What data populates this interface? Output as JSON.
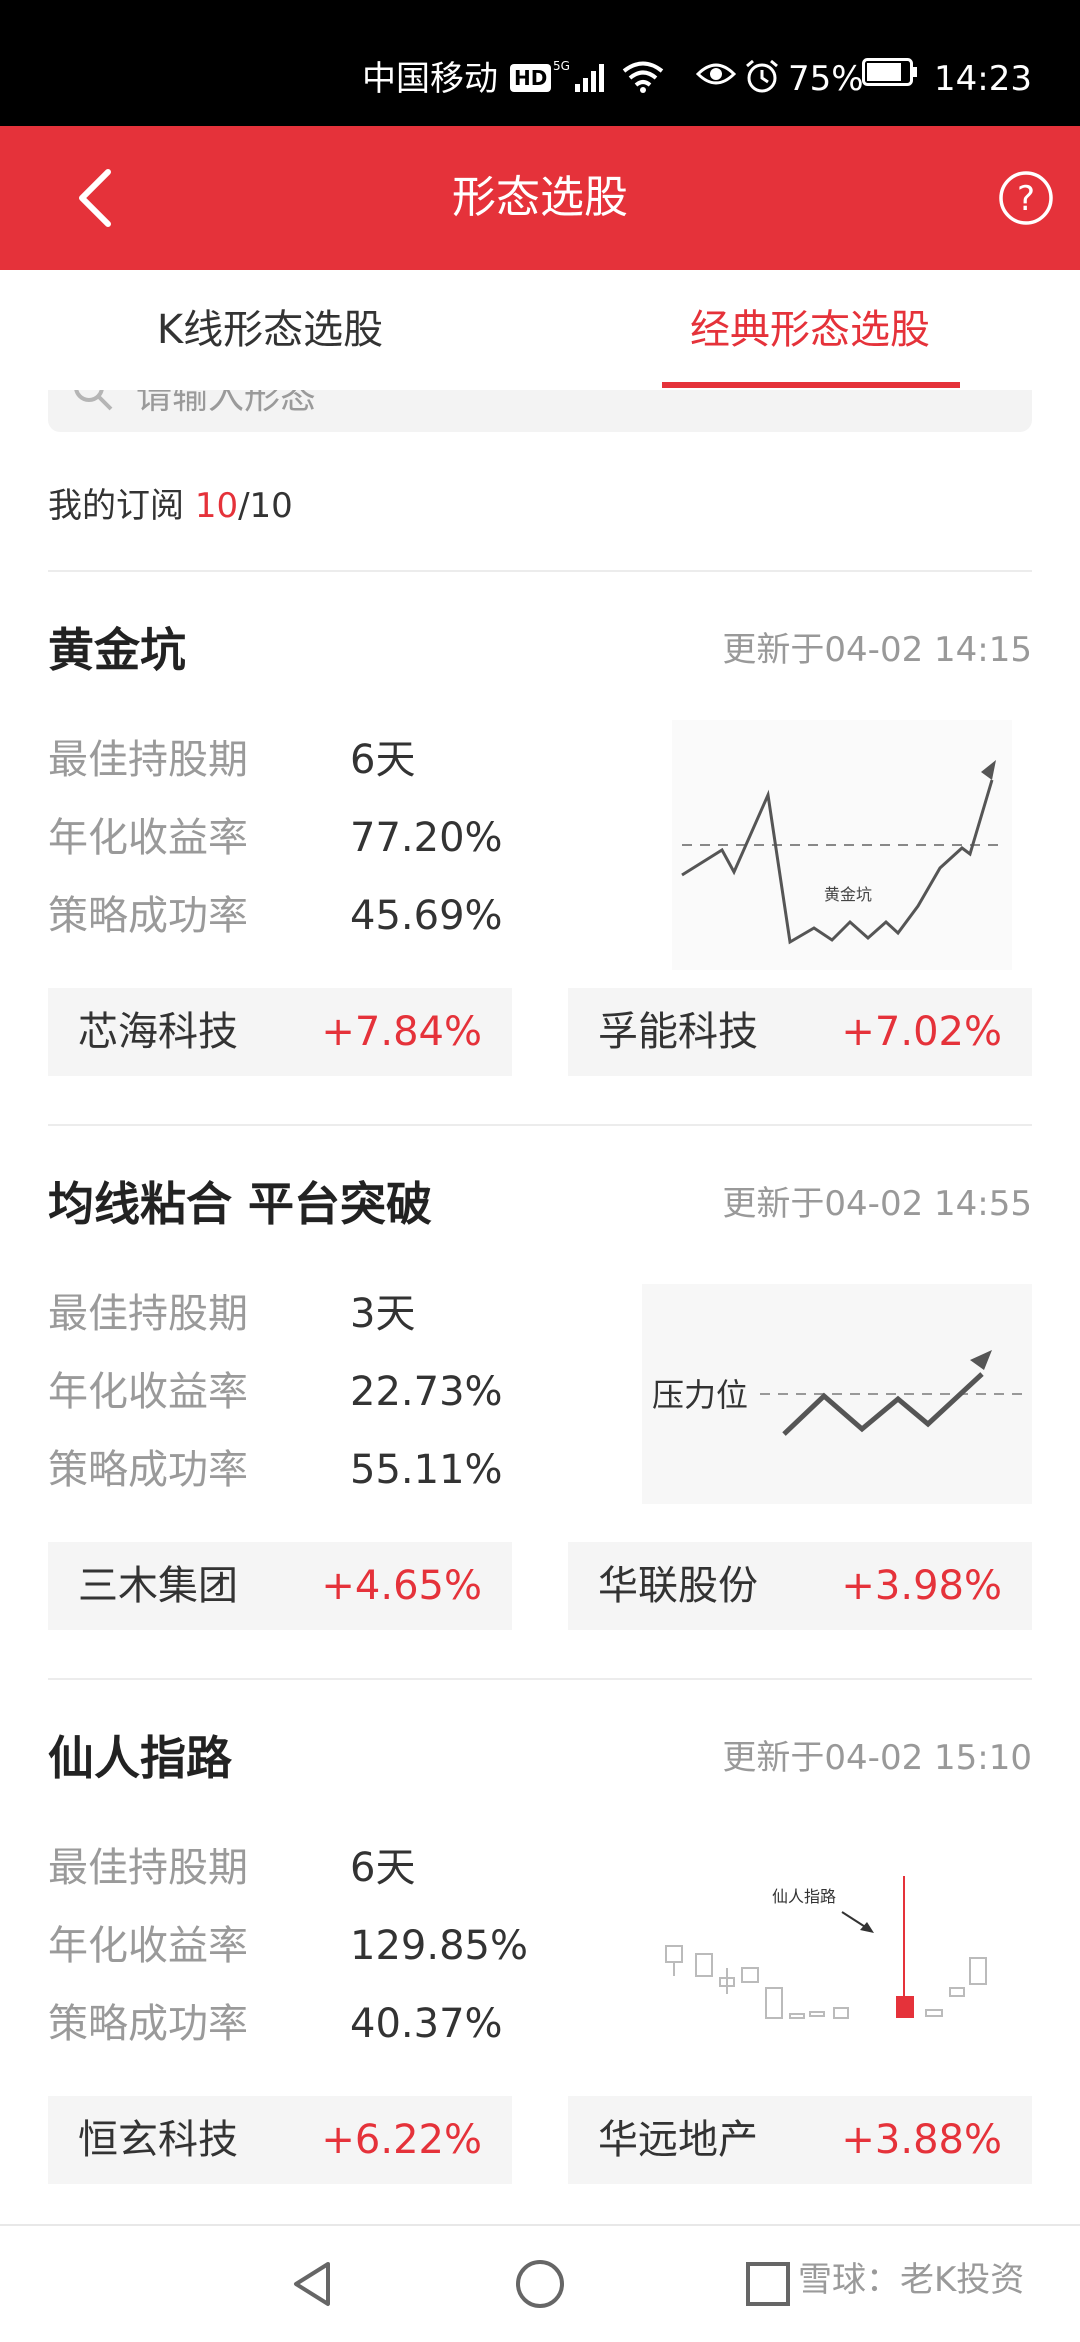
{
  "status_bar": {
    "carrier": "中国移动",
    "hd": "HD",
    "network": "5G",
    "battery": "75%",
    "time": "14:23"
  },
  "header": {
    "title": "形态选股"
  },
  "tabs": [
    {
      "label": "K线形态选股",
      "active": false
    },
    {
      "label": "经典形态选股",
      "active": true
    }
  ],
  "search": {
    "placeholder": "请输入形态"
  },
  "subscription": {
    "label": "我的订阅 ",
    "count": "10",
    "total": "/10"
  },
  "cards": [
    {
      "title": "黄金坑",
      "updated": "更新于04-02 14:15",
      "stats": [
        {
          "label": "最佳持股期",
          "value": "6天"
        },
        {
          "label": "年化收益率",
          "value": "77.20%"
        },
        {
          "label": "策略成功率",
          "value": "45.69%"
        }
      ],
      "pattern_label": "黄金坑",
      "stocks": [
        {
          "name": "芯海科技",
          "change": "+7.84%"
        },
        {
          "name": "孚能科技",
          "change": "+7.02%"
        }
      ]
    },
    {
      "title": "均线粘合 平台突破",
      "updated": "更新于04-02 14:55",
      "stats": [
        {
          "label": "最佳持股期",
          "value": "3天"
        },
        {
          "label": "年化收益率",
          "value": "22.73%"
        },
        {
          "label": "策略成功率",
          "value": "55.11%"
        }
      ],
      "pattern_label": "压力位",
      "stocks": [
        {
          "name": "三木集团",
          "change": "+4.65%"
        },
        {
          "name": "华联股份",
          "change": "+3.98%"
        }
      ]
    },
    {
      "title": "仙人指路",
      "updated": "更新于04-02 15:10",
      "stats": [
        {
          "label": "最佳持股期",
          "value": "6天"
        },
        {
          "label": "年化收益率",
          "value": "129.85%"
        },
        {
          "label": "策略成功率",
          "value": "40.37%"
        }
      ],
      "pattern_label": "仙人指路",
      "stocks": [
        {
          "name": "恒玄科技",
          "change": "+6.22%"
        },
        {
          "name": "华远地产",
          "change": "+3.88%"
        }
      ]
    }
  ],
  "watermark": "雪球：老K投资",
  "colors": {
    "accent": "#e5323a",
    "muted": "#9a9a9a"
  }
}
